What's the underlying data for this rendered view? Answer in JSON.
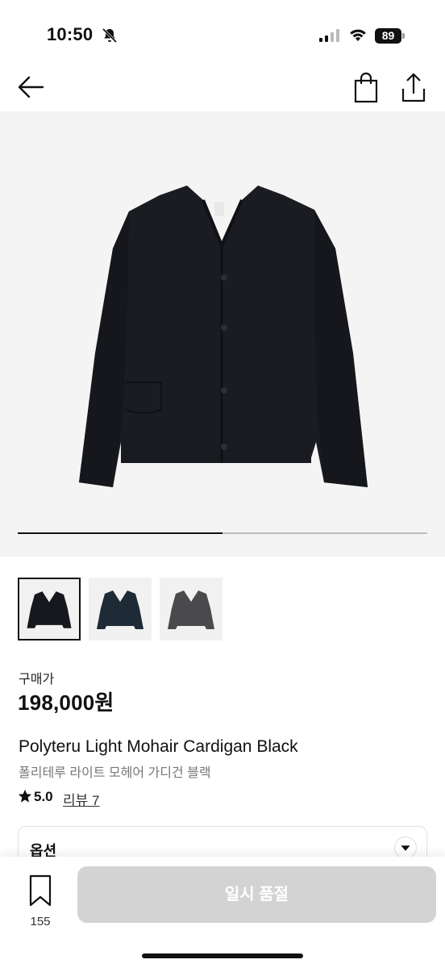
{
  "status_bar": {
    "time": "10:50",
    "battery": "89"
  },
  "nav": {
    "icons": [
      "back-arrow-icon",
      "shopping-bag-icon",
      "share-icon"
    ]
  },
  "product": {
    "price_label": "구매가",
    "price": "198,000원",
    "name": "Polyteru Light Mohair Cardigan Black",
    "name_ko": "폴리테루 라이트 모헤어 가디건 블랙",
    "rating": "5.0",
    "review_link": "리뷰 7"
  },
  "gallery": {
    "progress": 0.5,
    "thumbnail_colors": [
      "#16181d",
      "#1e2a36",
      "#4a4a4d"
    ],
    "selected_index": 0
  },
  "option": {
    "label": "옵션"
  },
  "bottom_bar": {
    "bookmark_count": "155",
    "action_label": "일시 품절"
  },
  "colors": {
    "accent": "#111111",
    "disabled_button": "#d3d3d3",
    "hero_background": "#f4f4f4"
  }
}
